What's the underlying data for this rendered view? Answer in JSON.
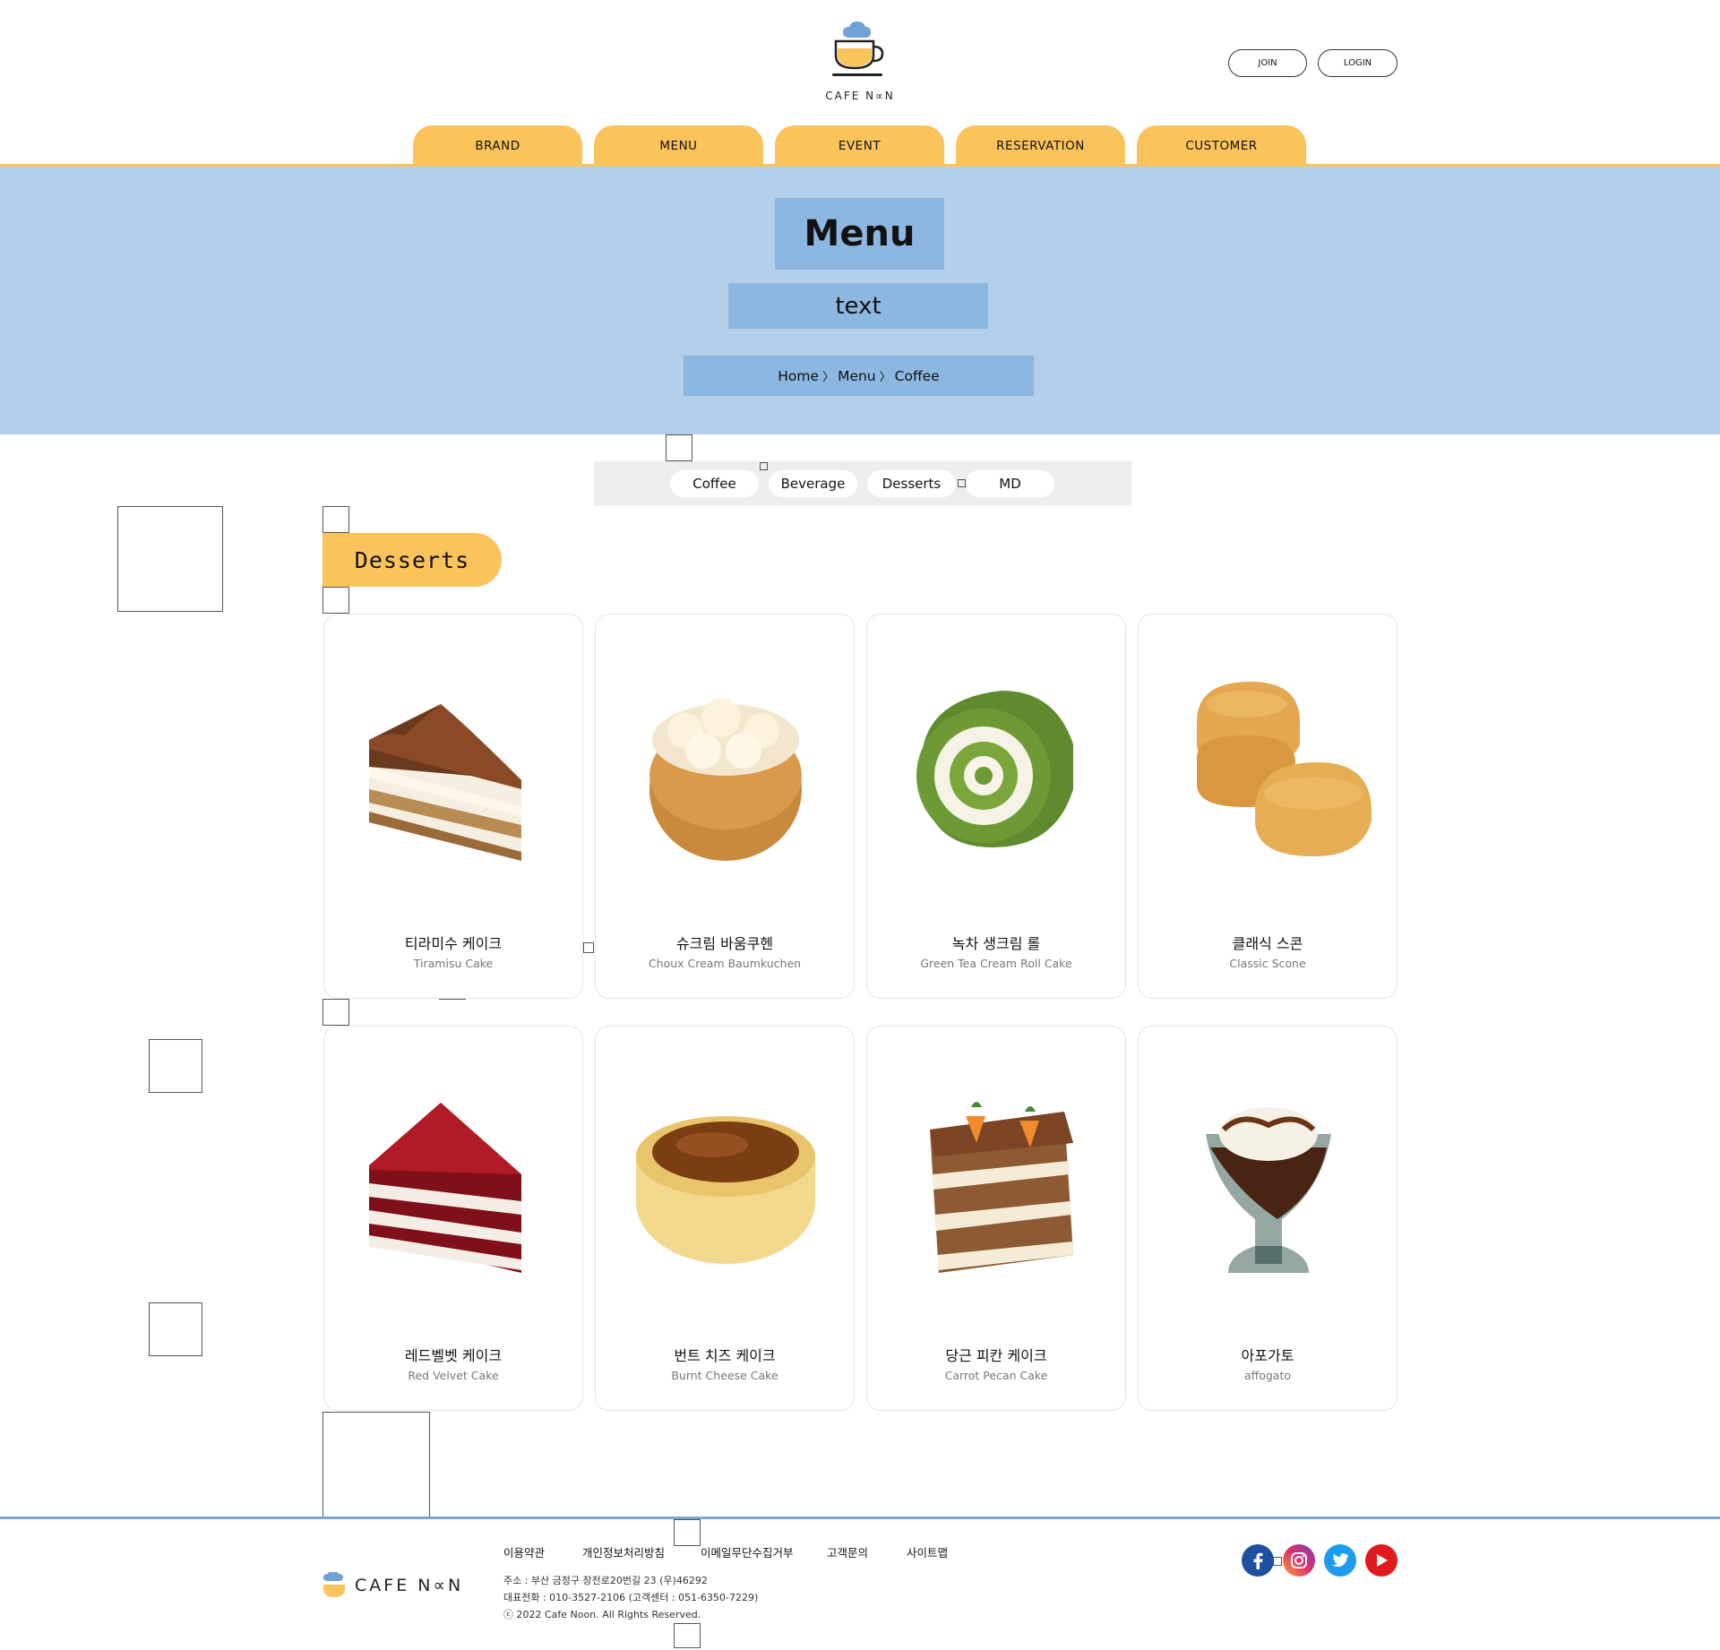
{
  "brand": {
    "logo_text": "CAFE N∝N",
    "colors": {
      "accent": "#fbc35b",
      "hero_bg": "#b3cfe9",
      "hero_box": "#8cb7e0",
      "footer_line": "#7ba4d6"
    }
  },
  "auth": {
    "join_label": "JOIN",
    "login_label": "LOGIN"
  },
  "nav": {
    "items": [
      {
        "label": "BRAND"
      },
      {
        "label": "MENU"
      },
      {
        "label": "EVENT"
      },
      {
        "label": "RESERVATION"
      },
      {
        "label": "CUSTOMER"
      }
    ]
  },
  "hero": {
    "title": "Menu",
    "subtitle": "text",
    "breadcrumb": [
      "Home",
      "Menu",
      "Coffee"
    ],
    "breadcrumb_separator": "〉"
  },
  "tabs": {
    "items": [
      {
        "label": "Coffee"
      },
      {
        "label": "Beverage"
      },
      {
        "label": "Desserts"
      },
      {
        "label": "MD"
      }
    ]
  },
  "section": {
    "title": "Desserts"
  },
  "products": [
    {
      "name_ko": "티라미수 케이크",
      "name_en": "Tiramisu Cake",
      "image": "tiramisu-cake-image"
    },
    {
      "name_ko": "슈크림 바움쿠헨",
      "name_en": "Choux Cream Baumkuchen",
      "image": "choux-baumkuchen-image"
    },
    {
      "name_ko": "녹차 생크림 롤",
      "name_en": "Green Tea Cream Roll Cake",
      "image": "green-tea-roll-image"
    },
    {
      "name_ko": "클래식 스콘",
      "name_en": "Classic Scone",
      "image": "scone-image"
    },
    {
      "name_ko": "레드벨벳 케이크",
      "name_en": "Red Velvet Cake",
      "image": "red-velvet-cake-image"
    },
    {
      "name_ko": "번트 치즈 케이크",
      "name_en": "Burnt Cheese Cake",
      "image": "burnt-cheese-cake-image"
    },
    {
      "name_ko": "당근 피칸 케이크",
      "name_en": "Carrot Pecan Cake",
      "image": "carrot-pecan-cake-image"
    },
    {
      "name_ko": "아포가토",
      "name_en": "affogato",
      "image": "affogato-image"
    }
  ],
  "footer": {
    "logo_text": "CAFE N∝N",
    "links": [
      {
        "label": "이용약관"
      },
      {
        "label": "개인정보처리방침"
      },
      {
        "label": "이메일무단수집거부"
      },
      {
        "label": "고객문의"
      },
      {
        "label": "사이트맵"
      }
    ],
    "address": "주소 : 부산 금정구 장전로20번길 23 (우)46292",
    "phone": "대표전화 : 010-3527-2106 (고객센터 : 051-6350-7229)",
    "copyright": "ⓒ 2022 Cafe Noon. All Rights Reserved.",
    "social": [
      {
        "name": "facebook-icon"
      },
      {
        "name": "instagram-icon"
      },
      {
        "name": "twitter-icon"
      },
      {
        "name": "youtube-icon"
      }
    ]
  }
}
